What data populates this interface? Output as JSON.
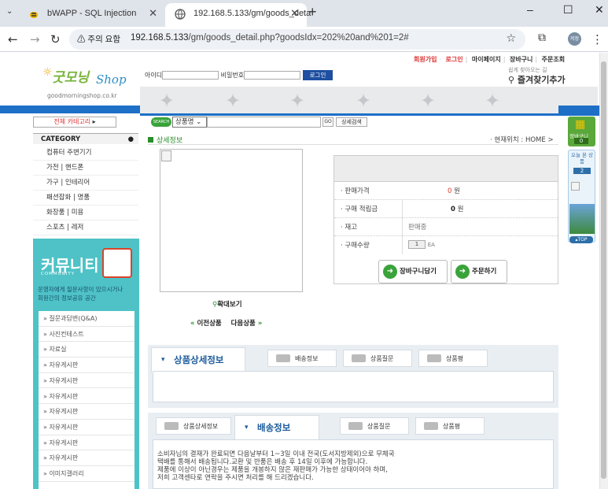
{
  "browser": {
    "tabs": [
      {
        "title": "bWAPP - SQL Injection",
        "active": false
      },
      {
        "title": "192.168.5.133/gm/goods_deta",
        "active": true
      }
    ],
    "new_tab": "+",
    "window_buttons": [
      "–",
      "☐",
      "✕"
    ],
    "security_warning": "주의 요함",
    "url_host": "192.168.5.133",
    "url_path": "/gm/goods_detail.php?goodsIdx=202%20and%201=2#",
    "profile_label": "저정"
  },
  "header": {
    "top_links": {
      "signup": "회원가입",
      "login": "로그인",
      "mypage": "마이페이지",
      "cart": "장바구니",
      "order": "주문조회"
    },
    "logo_text": "굿모닝",
    "logo_shop": "Shop",
    "logo_url": "goodmorningshop.co.kr",
    "login": {
      "id_label": "아이디",
      "pw_label": "비밀번호",
      "button": "로그인"
    },
    "favorite_small": "쉽게 찾아오는 길",
    "favorite": "즐겨찾기추가"
  },
  "sidebar": {
    "all_categories": "전체 카테고리",
    "category_header": "CATEGORY",
    "categories": [
      "컴퓨터 주변기기",
      "가전 | 핸드폰",
      "가구 | 인테리어",
      "패션잡화 | 명품",
      "화장품 | 미용",
      "스포츠 | 레저"
    ],
    "community_title": "커뮤니티",
    "community_sub": "COMMUNITY",
    "community_desc1": "운영자에게 질문사항이 있으시거나",
    "community_desc2": "회원간의 정보공유 공간",
    "community_items": [
      "질문과답변(Q&A)",
      "사진컨테스트",
      "자료실",
      "자유게시판",
      "자유게시판",
      "자유게시판",
      "자유게시판",
      "자유게시판",
      "자유게시판",
      "자유게시판",
      "이미지갤러리"
    ]
  },
  "search": {
    "badge": "SEARCH",
    "select_value": "상품명",
    "go": "GO",
    "detail": "상세검색"
  },
  "main": {
    "section_title": "상세정보",
    "location": "현재위치 : HOME >",
    "zoom": "확대보기",
    "prev": "이전상품",
    "next": "다음상품",
    "info": {
      "price_label": "판매가격",
      "price_value": "0",
      "price_unit": "원",
      "points_label": "구매 적립금",
      "points_value": "0",
      "points_unit": "원",
      "stock_label": "재고",
      "stock_value": "판매중",
      "qty_label": "구매수량",
      "qty_value": "1",
      "qty_unit": "EA"
    },
    "cart_button": "장바구니담기",
    "order_button": "주문하기"
  },
  "detail_tabs": {
    "section1": {
      "active": "상품상세정보",
      "others": [
        "배송정보",
        "상품질문",
        "상품평"
      ]
    },
    "section2": {
      "first": "상품상세정보",
      "active": "배송정보",
      "others": [
        "상품질문",
        "상품평"
      ]
    },
    "shipping_text": [
      "소비자님의 결재가 완료되면 다음날부터 1~3일 이내 전국(도서지방제외)으로 무체국",
      "택배를 통해서 배송됩니다.교환 및 반품은 배송 후 14일 이후에 가능합니다.",
      "제품에 이상이 아닌경우는 제품을 개봉하지 않은 재판매가 가능한 상태이어야 하며,",
      "저희 고객센타로 연락을 주시면 처리를 해 드리겠습니다."
    ]
  },
  "right_widgets": {
    "cart_label": "장바구니",
    "cart_count": "0",
    "today_label": "오늘 본 상품",
    "today_count": "2",
    "top_label": "TOP"
  },
  "colors": {
    "brand_blue": "#1e6fc6",
    "brand_green": "#2a8e2a",
    "community": "#4ec2c6",
    "price_red": "#e03c28"
  }
}
